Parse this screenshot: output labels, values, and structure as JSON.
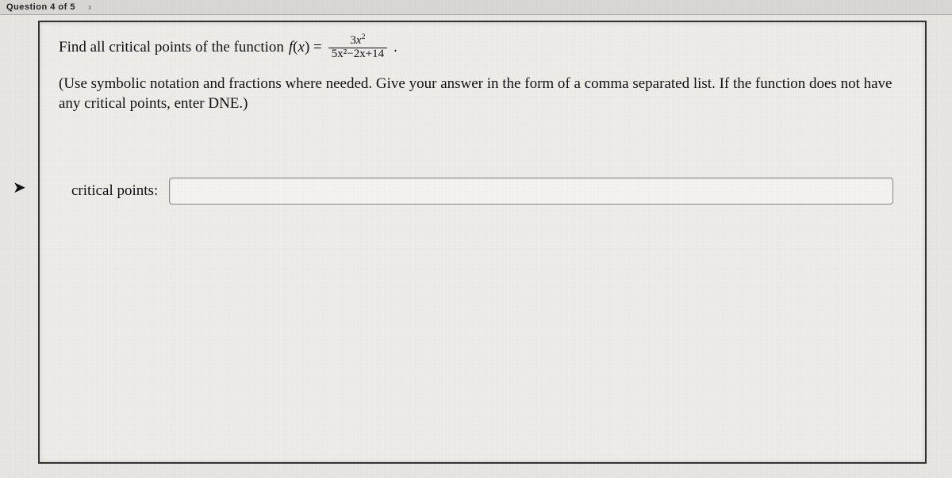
{
  "topbar": {
    "question_indicator": "Question 4 of 5",
    "next_glyph": "›"
  },
  "prompt": {
    "lead": "Find all critical points of the function",
    "func_name": "f",
    "func_arg": "x",
    "equals": "=",
    "numerator_coeff": "3",
    "numerator_var": "x",
    "numerator_exp": "2",
    "denominator": "5x²−2x+14",
    "period": "."
  },
  "instructions": "(Use symbolic notation and fractions where needed. Give your answer in the form of a comma separated list. If the function does not have any critical points, enter DNE.)",
  "answer": {
    "label": "critical points:",
    "value": ""
  },
  "cursor_glyph": "➤"
}
